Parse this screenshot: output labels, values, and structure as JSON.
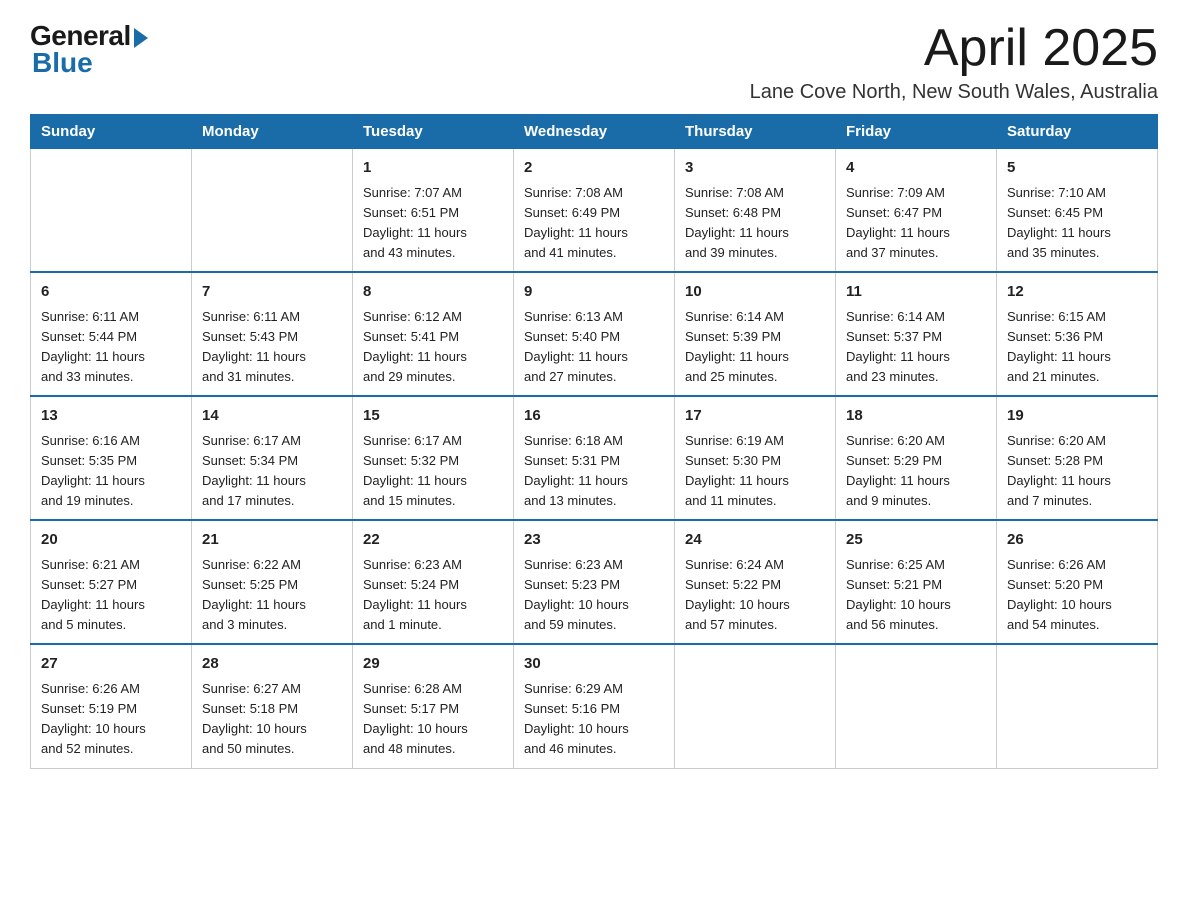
{
  "logo": {
    "general": "General",
    "blue": "Blue"
  },
  "title": "April 2025",
  "location": "Lane Cove North, New South Wales, Australia",
  "days": [
    "Sunday",
    "Monday",
    "Tuesday",
    "Wednesday",
    "Thursday",
    "Friday",
    "Saturday"
  ],
  "weeks": [
    [
      {
        "day": "",
        "info": ""
      },
      {
        "day": "",
        "info": ""
      },
      {
        "day": "1",
        "info": "Sunrise: 7:07 AM\nSunset: 6:51 PM\nDaylight: 11 hours\nand 43 minutes."
      },
      {
        "day": "2",
        "info": "Sunrise: 7:08 AM\nSunset: 6:49 PM\nDaylight: 11 hours\nand 41 minutes."
      },
      {
        "day": "3",
        "info": "Sunrise: 7:08 AM\nSunset: 6:48 PM\nDaylight: 11 hours\nand 39 minutes."
      },
      {
        "day": "4",
        "info": "Sunrise: 7:09 AM\nSunset: 6:47 PM\nDaylight: 11 hours\nand 37 minutes."
      },
      {
        "day": "5",
        "info": "Sunrise: 7:10 AM\nSunset: 6:45 PM\nDaylight: 11 hours\nand 35 minutes."
      }
    ],
    [
      {
        "day": "6",
        "info": "Sunrise: 6:11 AM\nSunset: 5:44 PM\nDaylight: 11 hours\nand 33 minutes."
      },
      {
        "day": "7",
        "info": "Sunrise: 6:11 AM\nSunset: 5:43 PM\nDaylight: 11 hours\nand 31 minutes."
      },
      {
        "day": "8",
        "info": "Sunrise: 6:12 AM\nSunset: 5:41 PM\nDaylight: 11 hours\nand 29 minutes."
      },
      {
        "day": "9",
        "info": "Sunrise: 6:13 AM\nSunset: 5:40 PM\nDaylight: 11 hours\nand 27 minutes."
      },
      {
        "day": "10",
        "info": "Sunrise: 6:14 AM\nSunset: 5:39 PM\nDaylight: 11 hours\nand 25 minutes."
      },
      {
        "day": "11",
        "info": "Sunrise: 6:14 AM\nSunset: 5:37 PM\nDaylight: 11 hours\nand 23 minutes."
      },
      {
        "day": "12",
        "info": "Sunrise: 6:15 AM\nSunset: 5:36 PM\nDaylight: 11 hours\nand 21 minutes."
      }
    ],
    [
      {
        "day": "13",
        "info": "Sunrise: 6:16 AM\nSunset: 5:35 PM\nDaylight: 11 hours\nand 19 minutes."
      },
      {
        "day": "14",
        "info": "Sunrise: 6:17 AM\nSunset: 5:34 PM\nDaylight: 11 hours\nand 17 minutes."
      },
      {
        "day": "15",
        "info": "Sunrise: 6:17 AM\nSunset: 5:32 PM\nDaylight: 11 hours\nand 15 minutes."
      },
      {
        "day": "16",
        "info": "Sunrise: 6:18 AM\nSunset: 5:31 PM\nDaylight: 11 hours\nand 13 minutes."
      },
      {
        "day": "17",
        "info": "Sunrise: 6:19 AM\nSunset: 5:30 PM\nDaylight: 11 hours\nand 11 minutes."
      },
      {
        "day": "18",
        "info": "Sunrise: 6:20 AM\nSunset: 5:29 PM\nDaylight: 11 hours\nand 9 minutes."
      },
      {
        "day": "19",
        "info": "Sunrise: 6:20 AM\nSunset: 5:28 PM\nDaylight: 11 hours\nand 7 minutes."
      }
    ],
    [
      {
        "day": "20",
        "info": "Sunrise: 6:21 AM\nSunset: 5:27 PM\nDaylight: 11 hours\nand 5 minutes."
      },
      {
        "day": "21",
        "info": "Sunrise: 6:22 AM\nSunset: 5:25 PM\nDaylight: 11 hours\nand 3 minutes."
      },
      {
        "day": "22",
        "info": "Sunrise: 6:23 AM\nSunset: 5:24 PM\nDaylight: 11 hours\nand 1 minute."
      },
      {
        "day": "23",
        "info": "Sunrise: 6:23 AM\nSunset: 5:23 PM\nDaylight: 10 hours\nand 59 minutes."
      },
      {
        "day": "24",
        "info": "Sunrise: 6:24 AM\nSunset: 5:22 PM\nDaylight: 10 hours\nand 57 minutes."
      },
      {
        "day": "25",
        "info": "Sunrise: 6:25 AM\nSunset: 5:21 PM\nDaylight: 10 hours\nand 56 minutes."
      },
      {
        "day": "26",
        "info": "Sunrise: 6:26 AM\nSunset: 5:20 PM\nDaylight: 10 hours\nand 54 minutes."
      }
    ],
    [
      {
        "day": "27",
        "info": "Sunrise: 6:26 AM\nSunset: 5:19 PM\nDaylight: 10 hours\nand 52 minutes."
      },
      {
        "day": "28",
        "info": "Sunrise: 6:27 AM\nSunset: 5:18 PM\nDaylight: 10 hours\nand 50 minutes."
      },
      {
        "day": "29",
        "info": "Sunrise: 6:28 AM\nSunset: 5:17 PM\nDaylight: 10 hours\nand 48 minutes."
      },
      {
        "day": "30",
        "info": "Sunrise: 6:29 AM\nSunset: 5:16 PM\nDaylight: 10 hours\nand 46 minutes."
      },
      {
        "day": "",
        "info": ""
      },
      {
        "day": "",
        "info": ""
      },
      {
        "day": "",
        "info": ""
      }
    ]
  ]
}
